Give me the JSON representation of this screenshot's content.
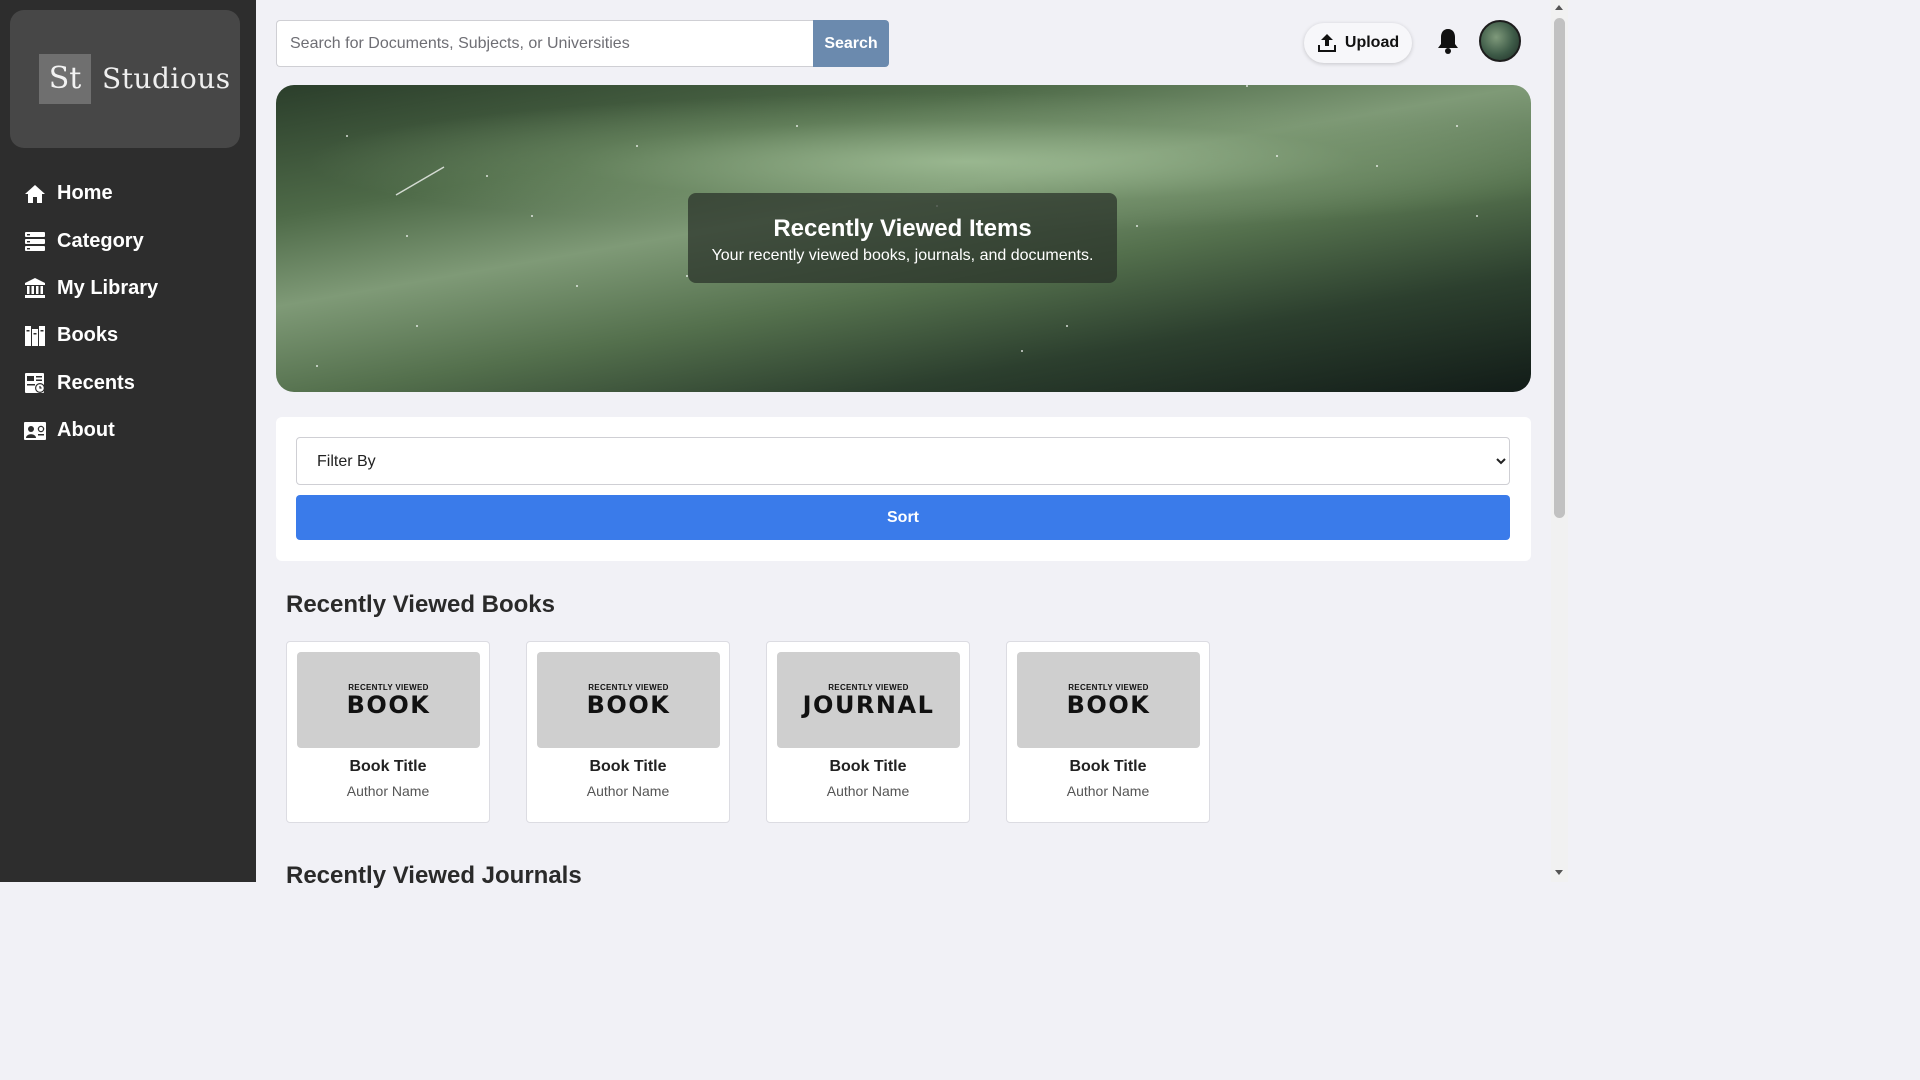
{
  "brand": {
    "mark": "St",
    "name": "Studious"
  },
  "sidebar": {
    "items": [
      {
        "label": "Home",
        "icon": "home-icon"
      },
      {
        "label": "Category",
        "icon": "category-icon"
      },
      {
        "label": "My Library",
        "icon": "library-icon"
      },
      {
        "label": "Books",
        "icon": "books-icon"
      },
      {
        "label": "Recents",
        "icon": "recents-icon"
      },
      {
        "label": "About",
        "icon": "about-icon"
      }
    ]
  },
  "search": {
    "placeholder": "Search for Documents, Subjects, or Universities",
    "button_label": "Search"
  },
  "header": {
    "upload_label": "Upload"
  },
  "hero": {
    "title": "Recently Viewed Items",
    "subtitle": "Your recently viewed books, journals, and documents."
  },
  "filter": {
    "select_value": "Filter By",
    "sort_label": "Sort"
  },
  "sections": {
    "books_title": "Recently Viewed Books",
    "journals_title": "Recently Viewed Journals"
  },
  "books": [
    {
      "cover_top": "RECENTLY VIEWED",
      "cover_main": "BOOK",
      "title": "Book Title",
      "author": "Author Name"
    },
    {
      "cover_top": "RECENTLY VIEWED",
      "cover_main": "BOOK",
      "title": "Book Title",
      "author": "Author Name"
    },
    {
      "cover_top": "RECENTLY VIEWED",
      "cover_main": "JOURNAL",
      "title": "Book Title",
      "author": "Author Name"
    },
    {
      "cover_top": "RECENTLY VIEWED",
      "cover_main": "BOOK",
      "title": "Book Title",
      "author": "Author Name"
    }
  ],
  "colors": {
    "sidebar_bg": "#2d2d2d",
    "search_button": "#6b8aae",
    "sort_button": "#3a7bea",
    "page_bg": "#f1f1f6"
  }
}
